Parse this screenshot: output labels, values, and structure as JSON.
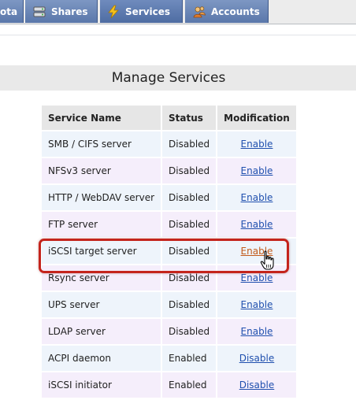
{
  "nav": {
    "tabs": [
      {
        "label": "ota",
        "icon": "chart-icon"
      },
      {
        "label": "Shares",
        "icon": "drive-icon"
      },
      {
        "label": "Services",
        "icon": "lightning-icon"
      },
      {
        "label": "Accounts",
        "icon": "users-icon"
      }
    ],
    "active_tab": "Services"
  },
  "page": {
    "title": "Manage Services"
  },
  "table": {
    "columns": [
      "Service Name",
      "Status",
      "Modification"
    ],
    "rows": [
      {
        "name": "SMB / CIFS server",
        "status": "Disabled",
        "action": "Enable"
      },
      {
        "name": "NFSv3 server",
        "status": "Disabled",
        "action": "Enable"
      },
      {
        "name": "HTTP / WebDAV server",
        "status": "Disabled",
        "action": "Enable"
      },
      {
        "name": "FTP server",
        "status": "Disabled",
        "action": "Enable"
      },
      {
        "name": "iSCSI target server",
        "status": "Disabled",
        "action": "Enable"
      },
      {
        "name": "Rsync server",
        "status": "Disabled",
        "action": "Enable"
      },
      {
        "name": "UPS server",
        "status": "Disabled",
        "action": "Enable"
      },
      {
        "name": "LDAP server",
        "status": "Disabled",
        "action": "Enable"
      },
      {
        "name": "ACPI daemon",
        "status": "Enabled",
        "action": "Disable"
      },
      {
        "name": "iSCSI initiator",
        "status": "Enabled",
        "action": "Disable"
      }
    ],
    "highlighted_row": "iSCSI target server"
  },
  "colors": {
    "tab_bg": "#5a77aa",
    "link": "#1f4fae",
    "link_hover": "#c25a1a",
    "highlight_ring": "#c4241c"
  }
}
